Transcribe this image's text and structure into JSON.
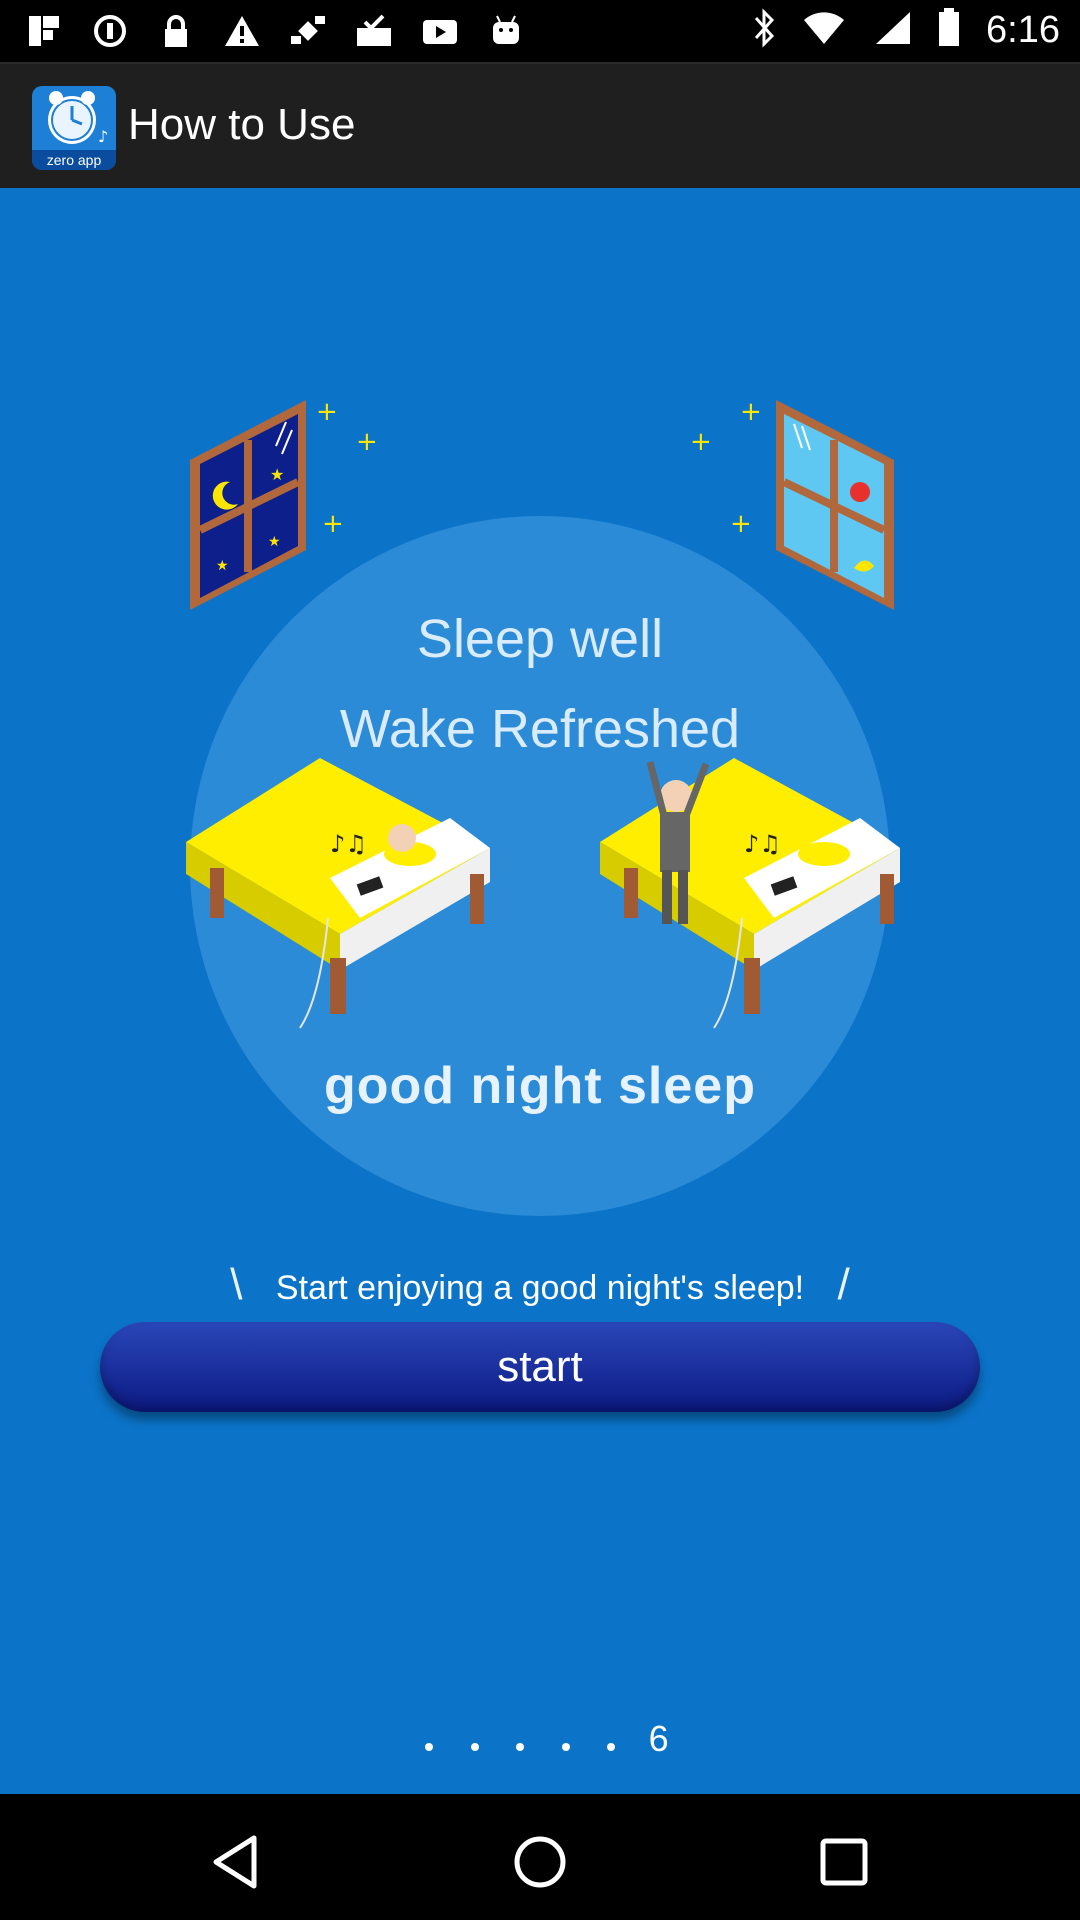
{
  "status_bar": {
    "time": "6:16",
    "left_icons": [
      "flipboard-icon",
      "circle-icon",
      "lock-icon",
      "warning-icon",
      "satellite-icon",
      "inbox-check-icon",
      "youtube-icon",
      "android-icon"
    ],
    "right_icons": [
      "bluetooth-icon",
      "wifi-icon",
      "signal-icon",
      "battery-icon"
    ]
  },
  "app_bar": {
    "title": "How to Use",
    "icon_label": "zero app"
  },
  "illustration": {
    "sleep_well": "Sleep well",
    "wake_refreshed": "Wake Refreshed",
    "good_night_sleep": "good night sleep"
  },
  "caption": {
    "text": "Start enjoying a good night's sleep!",
    "left_mark": "\\",
    "right_mark": "/"
  },
  "start_button": {
    "label": "start"
  },
  "pager": {
    "current_page": "6"
  },
  "colors": {
    "background": "#0b74c9",
    "circle": "#2b8bd6",
    "button_dark": "#0c1a84"
  }
}
